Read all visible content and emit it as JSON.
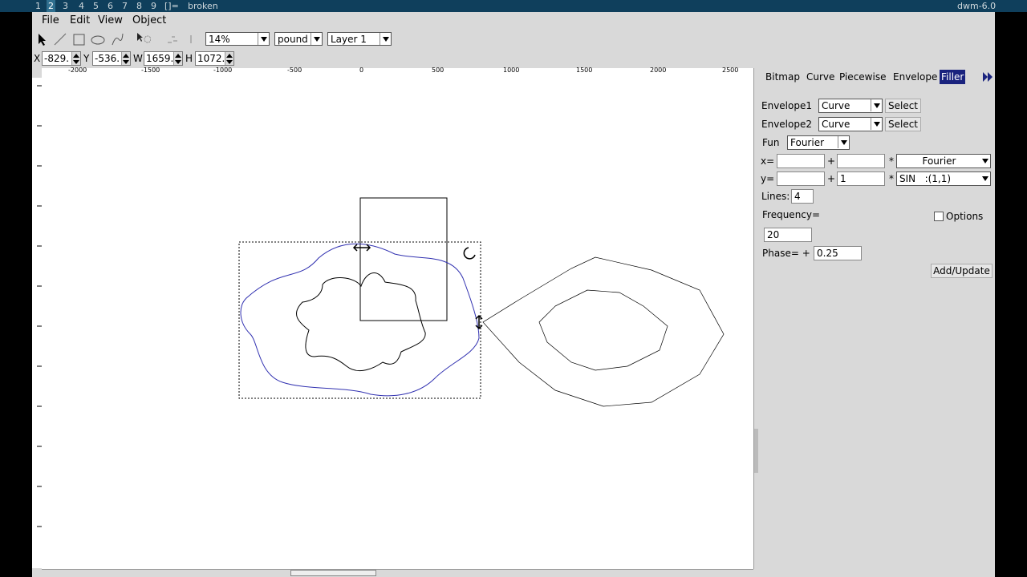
{
  "wm": {
    "workspaces": [
      "1",
      "2",
      "3",
      "4",
      "5",
      "6",
      "7",
      "8",
      "9",
      "[]="
    ],
    "active_index": 1,
    "title": "broken",
    "status": "dwm-6.0"
  },
  "menu": {
    "file": "File",
    "edit": "Edit",
    "view": "View",
    "object": "Object"
  },
  "toolbar": {
    "zoom": "14%",
    "units": "pound",
    "layer": "Layer 1"
  },
  "coords": {
    "x_label": "X",
    "x_value": "-829.",
    "y_label": "Y",
    "y_value": "-536.",
    "w_label": "W",
    "w_value": "1659.",
    "h_label": "H",
    "h_value": "1072."
  },
  "ruler": {
    "ticks": [
      "-2000",
      "-1500",
      "-1000",
      "-500",
      "0",
      "500",
      "1000",
      "1500",
      "2000",
      "2500"
    ]
  },
  "panel": {
    "tabs": [
      "Bitmap",
      "Curve",
      "Piecewise",
      "Envelope",
      "Filler"
    ],
    "active_tab": "Filler",
    "envelope1_label": "Envelope1",
    "envelope1_value": "Curve",
    "envelope1_button": "Select",
    "envelope2_label": "Envelope2",
    "envelope2_value": "Curve",
    "envelope2_button": "Select",
    "fun_label": "Fun",
    "fun_value": "Fourier",
    "x_label": "x=",
    "x_a": "",
    "x_plus": "+",
    "x_b": "",
    "x_mul": "*",
    "x_fun": "Fourier",
    "y_label": "y=",
    "y_a": "",
    "y_plus": "+",
    "y_b": "1",
    "y_mul": "*",
    "y_fun": "SIN   :(1,1)",
    "lines_label": "Lines:",
    "lines_value": "4",
    "frequency_label": "Frequency=",
    "frequency_value": "20",
    "options_label": "Options",
    "phase_label": "Phase= +",
    "phase_value": "0.25",
    "add_update": "Add/Update"
  },
  "colors": {
    "wm_bar": "#0f3f5c",
    "active_tab": "#1a237e",
    "envelope_curve": "#3030b0"
  }
}
